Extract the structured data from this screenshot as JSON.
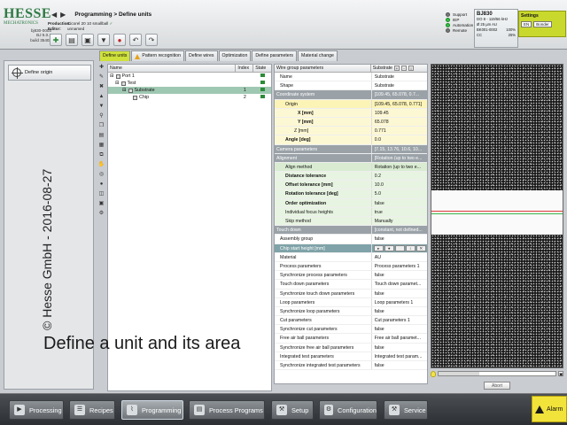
{
  "header": {
    "logo_big": "HESSE",
    "logo_small": "MECHATRONICS",
    "build_lines": [
      "bj830-0003",
      "BJ 5.0.2",
      "build 35403"
    ],
    "breadcrumb": "Programming > Define units",
    "production_label": "Production:",
    "production_value": "Cicorel 20 10 smallball",
    "editor_label": "Editor:",
    "editor_value": "unnamed",
    "check": "✓",
    "toolbar_icons": [
      "green-plus",
      "save",
      "save-as",
      "import",
      "stop",
      "undo",
      "redo"
    ]
  },
  "status": {
    "support": "Support",
    "iep": "IEP",
    "automation": "Automation",
    "remote": "Remote"
  },
  "machine": {
    "name": "BJ830",
    "sub": "DO 8 - 119/56 kHz",
    "row1": "Ø 25 µm AU",
    "row2": "BK001-0002",
    "row2_val": "100%",
    "row3": "CC",
    "row3_val": "25%"
  },
  "settings": {
    "title": "Settings",
    "options": [
      "EN",
      "Bonder"
    ]
  },
  "tabs": [
    {
      "label": "Define units",
      "active": true
    },
    {
      "label": "Pattern recognition",
      "warn": true
    },
    {
      "label": "Define wires"
    },
    {
      "label": "Optimization"
    },
    {
      "label": "Define parameters"
    },
    {
      "label": "Material change"
    }
  ],
  "left": {
    "define_origin": "Define origin",
    "watermark": "© Hesse GmbH - 2016-08-27"
  },
  "tree": {
    "headers": [
      "Name",
      "Index",
      "State"
    ],
    "rows": [
      {
        "name": "Port 1",
        "index": "",
        "indent": 0,
        "selected": false
      },
      {
        "name": "Test",
        "index": "",
        "indent": 1,
        "selected": false
      },
      {
        "name": "Substrate",
        "index": "1",
        "indent": 2,
        "selected": true
      },
      {
        "name": "Chip",
        "index": "2",
        "indent": 3,
        "selected": false
      }
    ]
  },
  "props": {
    "header_key": "Wire group parameters",
    "header_val": "Substrate",
    "rows": [
      {
        "k": "Name",
        "v": "Substrate",
        "style": ""
      },
      {
        "k": "Shape",
        "v": "Substrate",
        "style": ""
      },
      {
        "k": "Coordinate system",
        "v": "[109.45, 65.078, 0.7...",
        "style": "group"
      },
      {
        "k": "Origin",
        "v": "[109.45, 65.078, 0.771]",
        "style": "yellow ind1"
      },
      {
        "k": "X [mm]",
        "v": "109.45",
        "style": "yellow2 ind3"
      },
      {
        "k": "Y [mm]",
        "v": "65.078",
        "style": "yellow2 ind3"
      },
      {
        "k": "Z [mm]",
        "v": "0.771",
        "style": "yellow2 ind2"
      },
      {
        "k": "Angle [deg]",
        "v": "0.0",
        "style": "yellow2 ind1 bold"
      },
      {
        "k": "Camera parameters",
        "v": "[7.15, 13.76, 10.6, 10...",
        "style": "group"
      },
      {
        "k": "Alignment",
        "v": "[Rotation (up to two e...",
        "style": "group"
      },
      {
        "k": "Align method",
        "v": "Rotation (up to two e...",
        "style": "green ind1"
      },
      {
        "k": "Distance tolerance",
        "v": "0.2",
        "style": "green2 ind1 bold"
      },
      {
        "k": "Offset tolerance [mm]",
        "v": "10.0",
        "style": "green2 ind1 bold"
      },
      {
        "k": "Rotation tolerance [deg]",
        "v": "5.0",
        "style": "green2 ind1 bold"
      },
      {
        "k": "Order optimization",
        "v": "false",
        "style": "green2 ind1 bold"
      },
      {
        "k": "Individual focus heights",
        "v": "true",
        "style": "green2 ind1"
      },
      {
        "k": "Skip method",
        "v": "Manually",
        "style": "green2 ind1"
      },
      {
        "k": "Touch down",
        "v": "[constant, not defined...",
        "style": "group"
      },
      {
        "k": "Assembly group",
        "v": "false",
        "style": ""
      },
      {
        "k": "Chip start height [mm]",
        "v": "",
        "style": "sel2 ctl"
      },
      {
        "k": "Material",
        "v": "AU",
        "style": ""
      },
      {
        "k": "Process parameters",
        "v": "Process parameters 1",
        "style": ""
      },
      {
        "k": "Synchronize process parameters",
        "v": "false",
        "style": ""
      },
      {
        "k": "Touch down parameters",
        "v": "Touch down paramet...",
        "style": ""
      },
      {
        "k": "Synchronize touch down parameters",
        "v": "false",
        "style": ""
      },
      {
        "k": "Loop parameters",
        "v": "Loop parameters 1",
        "style": ""
      },
      {
        "k": "Synchronize loop parameters",
        "v": "false",
        "style": ""
      },
      {
        "k": "Cut parameters",
        "v": "Cut parameters 1",
        "style": ""
      },
      {
        "k": "Synchronize cut parameters",
        "v": "false",
        "style": ""
      },
      {
        "k": "Free air ball parameters",
        "v": "Free air ball paramet...",
        "style": ""
      },
      {
        "k": "Synchronize free air ball parameters",
        "v": "false",
        "style": ""
      },
      {
        "k": "Integrated test parameters",
        "v": "Integrated test param...",
        "style": ""
      },
      {
        "k": "Synchronize integrated test parameters",
        "v": "false",
        "style": ""
      }
    ],
    "ctl_buttons": [
      "▸",
      "●",
      "",
      "↕",
      "✕"
    ]
  },
  "camera": {
    "abort": "Abort",
    "light_level": 0.35
  },
  "overlay": "Define a unit and its area",
  "bottom_nav": [
    {
      "label": "Processing",
      "icon": "▶"
    },
    {
      "label": "Recipes",
      "icon": "☰"
    },
    {
      "label": "Programming",
      "icon": "⌇",
      "active": true
    },
    {
      "label": "Process Programs",
      "icon": "▤"
    },
    {
      "label": "Setup",
      "icon": "⚒"
    },
    {
      "label": "Configuration",
      "icon": "⚙"
    },
    {
      "label": "Service",
      "icon": "⚒"
    }
  ],
  "alarm": "Alarm"
}
